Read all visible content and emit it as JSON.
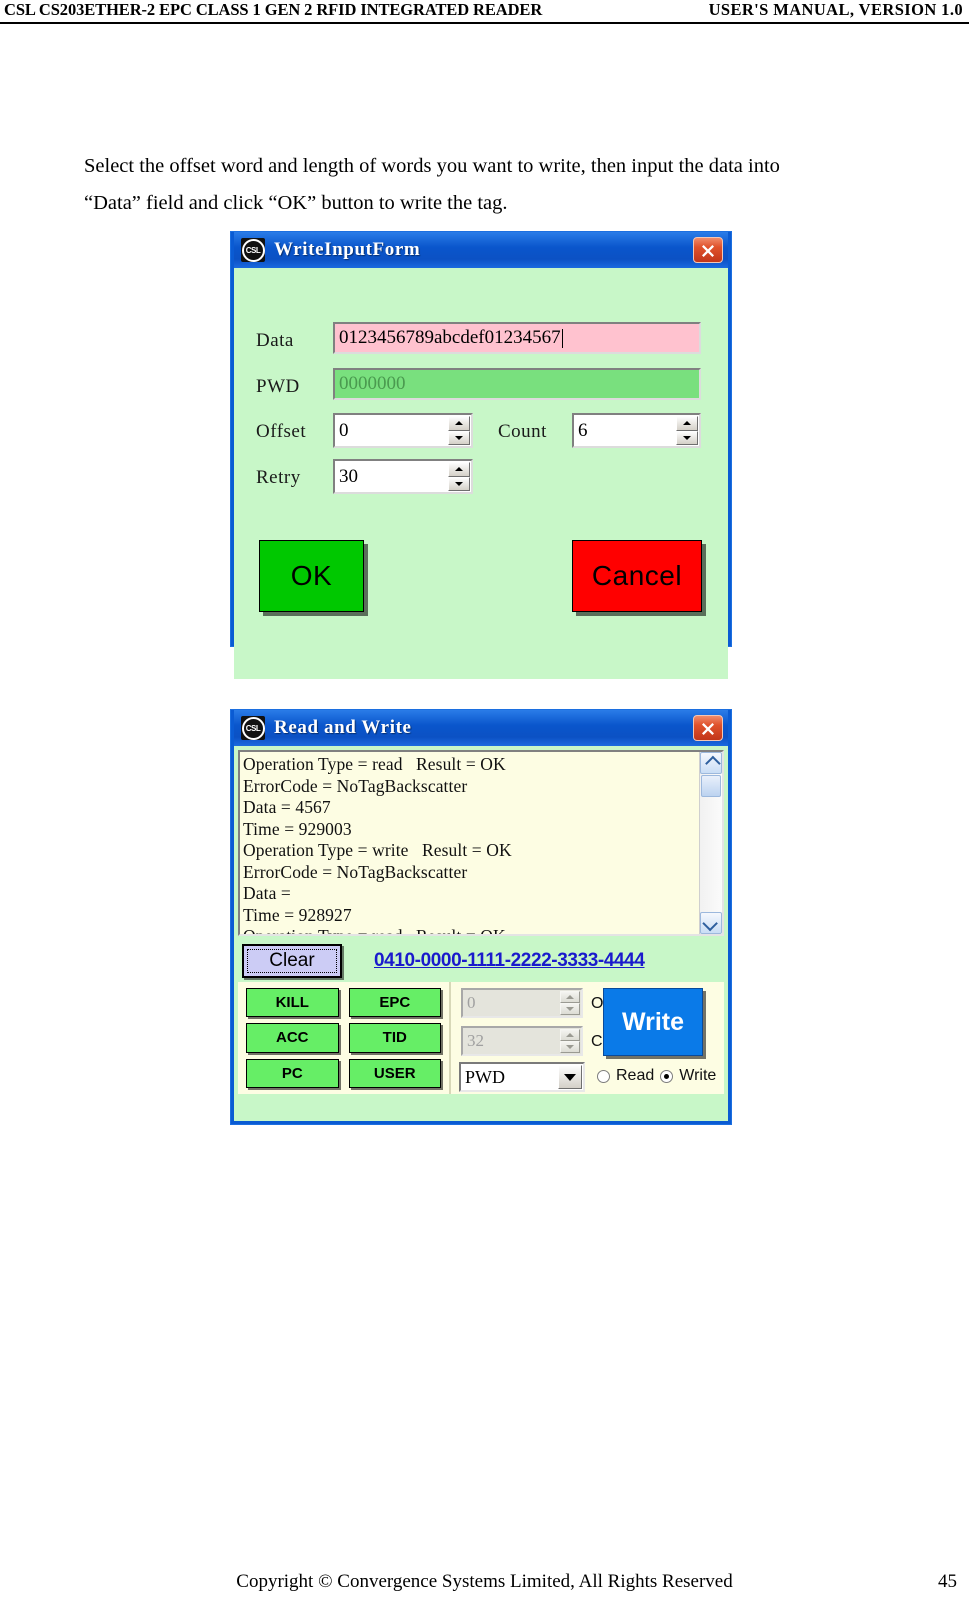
{
  "header": {
    "left": "CSL CS203ETHER-2 EPC CLASS 1 GEN 2 RFID INTEGRATED READER",
    "right": "USER'S  MANUAL,  VERSION  1.0"
  },
  "body": {
    "paragraph_line1": "Select the offset word and length of words you want to write, then input the data into",
    "paragraph_line2": "“Data” field and click “OK” button to write the tag."
  },
  "write_input_form": {
    "title": "WriteInputForm",
    "logo_text": "CSL",
    "close_label": "✕",
    "fields": {
      "data_label": "Data",
      "data_value": "0123456789abcdef01234567",
      "pwd_label": "PWD",
      "pwd_value": "0000000",
      "offset_label": "Offset",
      "offset_value": "0",
      "count_label": "Count",
      "count_value": "6",
      "retry_label": "Retry",
      "retry_value": "30"
    },
    "buttons": {
      "ok": "OK",
      "cancel": "Cancel"
    },
    "colors": {
      "titlebar": "#0a56cc",
      "body": "#c8f7c8",
      "data_field": "#ffc2cf",
      "pwd_field": "#79e07e",
      "ok": "#00c800",
      "cancel": "#ff0000"
    }
  },
  "read_and_write": {
    "title": "Read and Write",
    "logo_text": "CSL",
    "close_label": "✕",
    "log_lines": [
      "Operation Type = read   Result = OK",
      "ErrorCode = NoTagBackscatter",
      "Data = 4567",
      "Time = 929003",
      "Operation Type = write   Result = OK",
      "ErrorCode = NoTagBackscatter",
      "Data =",
      "Time = 928927",
      "Operation Type = read   Result = OK"
    ],
    "clear_button": "Clear",
    "epc_link": "0410-0000-1111-2222-3333-4444",
    "memory_buttons": [
      "KILL",
      "EPC",
      "ACC",
      "TID",
      "PC",
      "USER"
    ],
    "offset_label": "Offset",
    "offset_value": "0",
    "count_label": "Count",
    "count_value": "32",
    "bank_select_value": "PWD",
    "write_button": "Write",
    "radio_read_label": "Read",
    "radio_write_label": "Write",
    "radio_selected": "Write",
    "colors": {
      "log_bg": "#fdfde3",
      "panel_bg": "#c8f7c8",
      "mem_button": "#66ee66",
      "write_button": "#0a7ae8",
      "link": "#1a1acc"
    }
  },
  "footer": {
    "copyright": "Copyright © Convergence Systems Limited, All Rights Reserved",
    "page_number": "45"
  }
}
